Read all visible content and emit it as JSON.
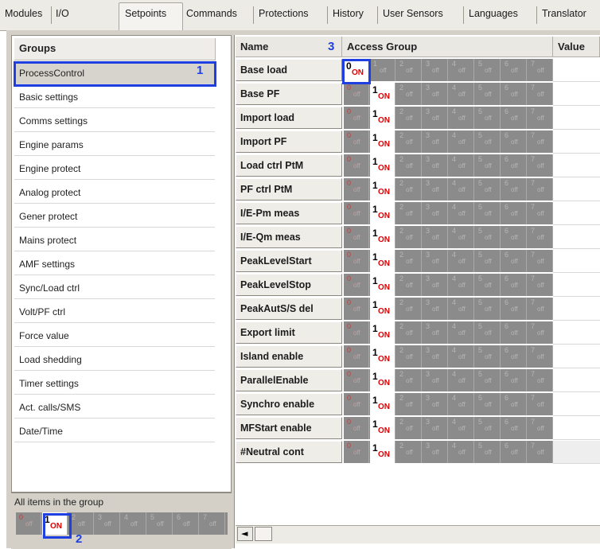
{
  "tabs": [
    "Modules",
    "I/O",
    "Setpoints",
    "Commands",
    "Protections",
    "History",
    "User Sensors",
    "Languages",
    "Translator"
  ],
  "active_tab": "Setpoints",
  "groups_panel": {
    "header": "Groups",
    "items": [
      "ProcessControl",
      "Basic settings",
      "Comms settings",
      "Engine params",
      "Engine protect",
      "Analog protect",
      "Gener protect",
      "Mains protect",
      "AMF settings",
      "Sync/Load ctrl",
      "Volt/PF ctrl",
      "Force value",
      "Load shedding",
      "Timer settings",
      "Act. calls/SMS",
      "Date/Time"
    ],
    "selected": "ProcessControl",
    "all_items_label": "All items in the group"
  },
  "grid": {
    "headers": {
      "name": "Name",
      "access": "Access Group",
      "value": "Value"
    },
    "level_numbers": [
      "0",
      "1",
      "2",
      "3",
      "4",
      "5",
      "6",
      "7"
    ],
    "state_on": "ON",
    "state_off": "off",
    "rows": [
      {
        "name": "Base load",
        "on_level": 0
      },
      {
        "name": "Base PF",
        "on_level": 1
      },
      {
        "name": "Import load",
        "on_level": 1
      },
      {
        "name": "Import PF",
        "on_level": 1
      },
      {
        "name": "Load ctrl PtM",
        "on_level": 1
      },
      {
        "name": "PF ctrl PtM",
        "on_level": 1
      },
      {
        "name": "I/E-Pm meas",
        "on_level": 1
      },
      {
        "name": "I/E-Qm meas",
        "on_level": 1
      },
      {
        "name": "PeakLevelStart",
        "on_level": 1
      },
      {
        "name": "PeakLevelStop",
        "on_level": 1
      },
      {
        "name": "PeakAutS/S del",
        "on_level": 1
      },
      {
        "name": "Export limit",
        "on_level": 1
      },
      {
        "name": "Island enable",
        "on_level": 1
      },
      {
        "name": "ParallelEnable",
        "on_level": 1
      },
      {
        "name": "Synchro enable",
        "on_level": 1
      },
      {
        "name": "MFStart enable",
        "on_level": 1
      },
      {
        "name": "#Neutral cont",
        "on_level": 1
      }
    ],
    "all_items_on_level": 1
  },
  "callouts": [
    "1",
    "2",
    "3"
  ],
  "colors": {
    "callout": "#1f3fe0",
    "on_text": "#e00000",
    "strip": "#8b8b8b"
  },
  "scroll_left_glyph": "◄"
}
